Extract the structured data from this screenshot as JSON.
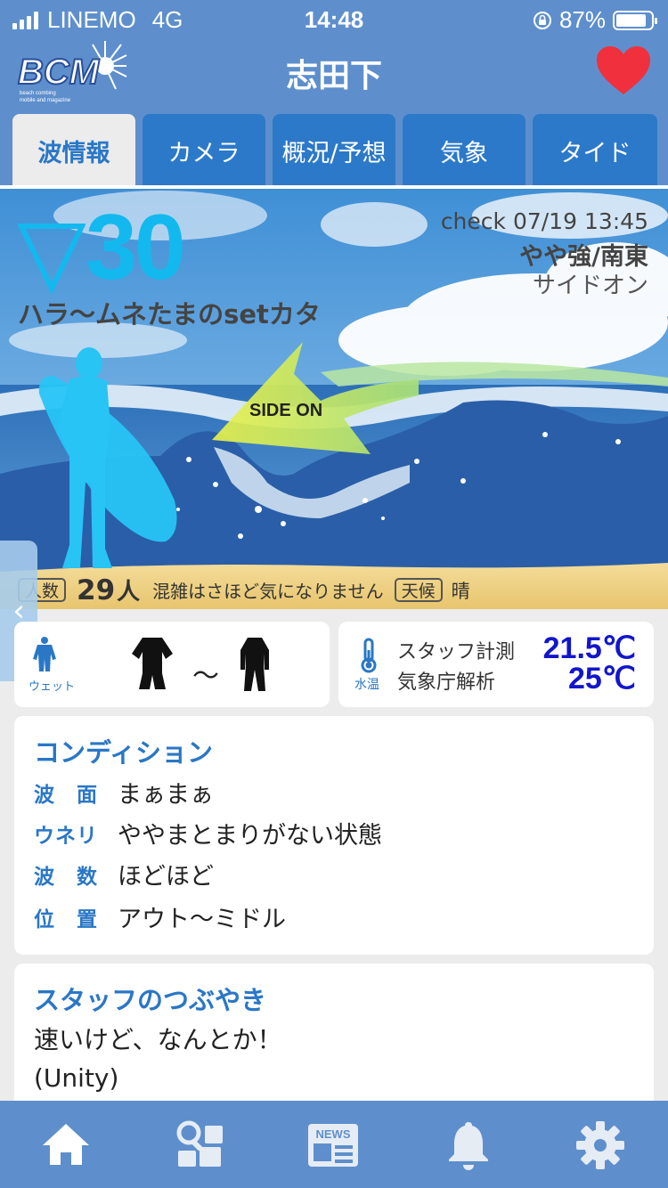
{
  "status_bar": {
    "carrier": "LINEMO",
    "network": "4G",
    "time": "14:48",
    "battery": "87%",
    "battery_level": 0.87
  },
  "header": {
    "logo_text": "BCM",
    "logo_subtext": "beach combing mobile and magazine",
    "title": "志田下",
    "favorite_icon": "heart-icon"
  },
  "tabs": [
    {
      "label": "波情報",
      "active": true
    },
    {
      "label": "カメラ",
      "active": false
    },
    {
      "label": "概況/予想",
      "active": false
    },
    {
      "label": "気象",
      "active": false
    },
    {
      "label": "タイド",
      "active": false
    }
  ],
  "surf": {
    "trend_icon": "down-triangle-icon",
    "wave_height": "30",
    "wave_description": "ハラ〜ムネたまのsetカタ",
    "check_time": "check 07/19 13:45",
    "wind": "やや強/南東",
    "wind_type": "サイドオン",
    "wind_badge": "SIDE ON",
    "crowd_tag": "人数",
    "crowd_count": "29",
    "crowd_unit": "人",
    "crowd_text": "混雑はさほど気になりません",
    "weather_tag": "天候",
    "weather": "晴"
  },
  "side_toggle": "‹",
  "wetsuit": {
    "label": "ウェット",
    "tilde": "〜"
  },
  "water_temp": {
    "label": "水温",
    "source_staff": "スタッフ計測",
    "source_jma": "気象庁解析",
    "value_staff": "21.5℃",
    "value_jma": "25℃"
  },
  "condition": {
    "title": "コンディション",
    "rows": [
      {
        "label": "波　面",
        "value": "まぁまぁ"
      },
      {
        "label": "ウネリ",
        "value": "ややまとまりがない状態"
      },
      {
        "label": "波　数",
        "value": "ほどほど"
      },
      {
        "label": "位　置",
        "value": "アウト〜ミドル"
      }
    ]
  },
  "staff_tweet": {
    "title": "スタッフのつぶやき",
    "lines": [
      "速いけど、なんとか！",
      "(Unity)"
    ]
  },
  "bottom_nav": [
    {
      "icon": "home-icon"
    },
    {
      "icon": "spot-search-icon"
    },
    {
      "icon": "news-icon",
      "label": "NEWS"
    },
    {
      "icon": "bell-icon"
    },
    {
      "icon": "gear-icon"
    }
  ],
  "colors": {
    "header_bg": "#5e8fcc",
    "tab_bg": "#2c79c9",
    "accent_blue": "#2a77c6",
    "wave_height": "#13b9ee",
    "water_temp": "#1116cc",
    "heart": "#f0303c"
  }
}
